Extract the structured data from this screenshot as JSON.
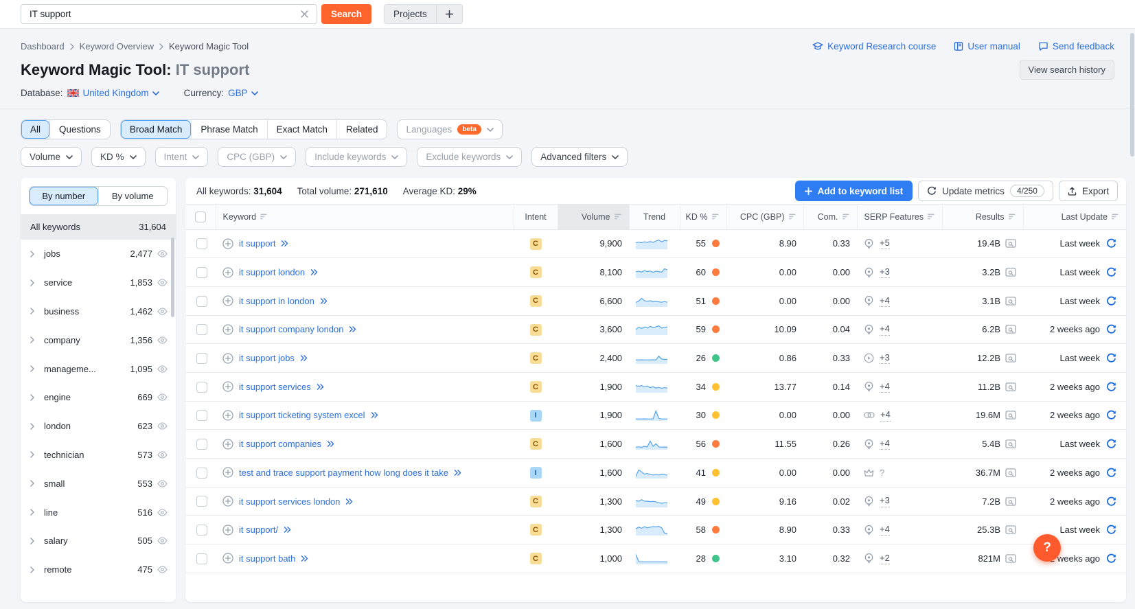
{
  "topbar": {
    "search_value": "IT support",
    "search_button": "Search",
    "projects_button": "Projects"
  },
  "header": {
    "breadcrumbs": [
      "Dashboard",
      "Keyword Overview",
      "Keyword Magic Tool"
    ],
    "links": [
      {
        "label": "Keyword Research course",
        "icon": "graduation-cap-icon"
      },
      {
        "label": "User manual",
        "icon": "book-icon"
      },
      {
        "label": "Send feedback",
        "icon": "feedback-icon"
      }
    ],
    "title_prefix": "Keyword Magic Tool:",
    "title_query": "IT support",
    "view_search_history": "View search history",
    "database_label": "Database:",
    "database_value": "United Kingdom",
    "currency_label": "Currency:",
    "currency_value": "GBP"
  },
  "filters": {
    "scope_tabs": [
      {
        "label": "All",
        "selected": true
      },
      {
        "label": "Questions",
        "selected": false
      }
    ],
    "match_tabs": [
      {
        "label": "Broad Match",
        "selected": true
      },
      {
        "label": "Phrase Match",
        "selected": false
      },
      {
        "label": "Exact Match",
        "selected": false
      },
      {
        "label": "Related",
        "selected": false
      }
    ],
    "languages": {
      "label": "Languages",
      "badge": "beta"
    },
    "dropdowns": [
      {
        "label": "Volume",
        "muted": false
      },
      {
        "label": "KD %",
        "muted": false
      },
      {
        "label": "Intent",
        "muted": true
      },
      {
        "label": "CPC (GBP)",
        "muted": true
      },
      {
        "label": "Include keywords",
        "muted": true
      },
      {
        "label": "Exclude keywords",
        "muted": true
      },
      {
        "label": "Advanced filters",
        "muted": false
      }
    ]
  },
  "sidebar": {
    "toggle": [
      {
        "label": "By number",
        "selected": true
      },
      {
        "label": "By volume",
        "selected": false
      }
    ],
    "all_row": {
      "label": "All keywords",
      "value": "31,604"
    },
    "groups": [
      {
        "label": "jobs",
        "value": "2,477"
      },
      {
        "label": "service",
        "value": "1,853"
      },
      {
        "label": "business",
        "value": "1,462"
      },
      {
        "label": "company",
        "value": "1,356"
      },
      {
        "label": "manageme...",
        "value": "1,095"
      },
      {
        "label": "engine",
        "value": "669"
      },
      {
        "label": "london",
        "value": "623"
      },
      {
        "label": "technician",
        "value": "573"
      },
      {
        "label": "small",
        "value": "553"
      },
      {
        "label": "line",
        "value": "516"
      },
      {
        "label": "salary",
        "value": "505"
      },
      {
        "label": "remote",
        "value": "475"
      }
    ]
  },
  "summary": {
    "all_keywords_label": "All keywords:",
    "all_keywords_value": "31,604",
    "total_volume_label": "Total volume:",
    "total_volume_value": "271,610",
    "avg_kd_label": "Average KD:",
    "avg_kd_value": "29%"
  },
  "actions": {
    "add_to_list": "Add to keyword list",
    "update_metrics": "Update metrics",
    "update_quota": "4/250",
    "export": "Export"
  },
  "table": {
    "columns": [
      {
        "key": "check",
        "label": "",
        "sortable": false,
        "align": "center",
        "sorted": false
      },
      {
        "key": "keyword",
        "label": "Keyword",
        "sortable": true,
        "align": "left",
        "sorted": false
      },
      {
        "key": "intent",
        "label": "Intent",
        "sortable": false,
        "align": "center",
        "sorted": false
      },
      {
        "key": "volume",
        "label": "Volume",
        "sortable": true,
        "align": "right",
        "sorted": true
      },
      {
        "key": "trend",
        "label": "Trend",
        "sortable": false,
        "align": "center",
        "sorted": false
      },
      {
        "key": "kd",
        "label": "KD %",
        "sortable": true,
        "align": "right",
        "sorted": false
      },
      {
        "key": "cpc",
        "label": "CPC (GBP)",
        "sortable": true,
        "align": "right",
        "sorted": false
      },
      {
        "key": "com",
        "label": "Com.",
        "sortable": true,
        "align": "right",
        "sorted": false
      },
      {
        "key": "serp",
        "label": "SERP Features",
        "sortable": true,
        "align": "left",
        "sorted": false
      },
      {
        "key": "results",
        "label": "Results",
        "sortable": true,
        "align": "right",
        "sorted": false
      },
      {
        "key": "update",
        "label": "Last Update",
        "sortable": true,
        "align": "right",
        "sorted": false
      }
    ],
    "rows": [
      {
        "keyword": "it support",
        "intent": "C",
        "volume": "9,900",
        "trend": [
          48,
          52,
          47,
          55,
          50,
          58,
          50,
          62,
          72,
          55,
          68,
          64
        ],
        "kd": "55",
        "kd_level": "hard",
        "cpc": "8.90",
        "com": "0.33",
        "serp_icon": "location-pin-icon",
        "serp_more": "+5",
        "results": "19.4B",
        "last_update": "Last week"
      },
      {
        "keyword": "it support london",
        "intent": "C",
        "volume": "8,100",
        "trend": [
          45,
          50,
          42,
          55,
          46,
          52,
          40,
          50,
          46,
          42,
          72,
          62
        ],
        "kd": "60",
        "kd_level": "hard",
        "cpc": "0.00",
        "com": "0.00",
        "serp_icon": "location-pin-icon",
        "serp_more": "+3",
        "results": "3.2B",
        "last_update": "Last week"
      },
      {
        "keyword": "it support in london",
        "intent": "C",
        "volume": "6,600",
        "trend": [
          28,
          40,
          66,
          44,
          38,
          44,
          34,
          38,
          34,
          30,
          36,
          30
        ],
        "kd": "51",
        "kd_level": "hard",
        "cpc": "0.00",
        "com": "0.00",
        "serp_icon": "location-pin-icon",
        "serp_more": "+4",
        "results": "3.1B",
        "last_update": "Last week"
      },
      {
        "keyword": "it support company london",
        "intent": "C",
        "volume": "3,600",
        "trend": [
          38,
          58,
          48,
          62,
          52,
          66,
          56,
          62,
          72,
          52,
          58,
          62
        ],
        "kd": "59",
        "kd_level": "hard",
        "cpc": "10.09",
        "com": "0.04",
        "serp_icon": "location-pin-icon",
        "serp_more": "+4",
        "results": "6.2B",
        "last_update": "2 weeks ago"
      },
      {
        "keyword": "it support jobs",
        "intent": "C",
        "volume": "2,400",
        "trend": [
          24,
          24,
          25,
          24,
          24,
          24,
          25,
          24,
          58,
          32,
          28,
          28
        ],
        "kd": "26",
        "kd_level": "easy",
        "cpc": "0.86",
        "com": "0.33",
        "serp_icon": "play-circle-icon",
        "serp_more": "+3",
        "results": "12.2B",
        "last_update": "Last week"
      },
      {
        "keyword": "it support services",
        "intent": "C",
        "volume": "1,900",
        "trend": [
          55,
          44,
          54,
          40,
          50,
          34,
          42,
          30,
          36,
          28,
          34,
          30
        ],
        "kd": "34",
        "kd_level": "medium",
        "cpc": "13.77",
        "com": "0.14",
        "serp_icon": "location-pin-icon",
        "serp_more": "+4",
        "results": "11.2B",
        "last_update": "2 weeks ago"
      },
      {
        "keyword": "it support ticketing system excel",
        "intent": "I",
        "volume": "1,900",
        "trend": [
          5,
          5,
          5,
          6,
          5,
          5,
          6,
          78,
          10,
          5,
          5,
          5
        ],
        "kd": "30",
        "kd_level": "medium",
        "cpc": "0.00",
        "com": "0.00",
        "serp_icon": "link-icon",
        "serp_more": "+4",
        "results": "19.6M",
        "last_update": "2 weeks ago"
      },
      {
        "keyword": "it support companies",
        "intent": "C",
        "volume": "1,600",
        "trend": [
          10,
          14,
          10,
          18,
          14,
          66,
          18,
          42,
          14,
          10,
          12,
          10
        ],
        "kd": "56",
        "kd_level": "hard",
        "cpc": "11.55",
        "com": "0.26",
        "serp_icon": "location-pin-icon",
        "serp_more": "+4",
        "results": "5.4B",
        "last_update": "Last week"
      },
      {
        "keyword": "test and trace support payment how long does it take",
        "intent": "I",
        "volume": "1,600",
        "trend": [
          8,
          66,
          48,
          28,
          34,
          24,
          20,
          24,
          20,
          28,
          24,
          18
        ],
        "kd": "41",
        "kd_level": "medium",
        "cpc": "0.00",
        "com": "0.00",
        "serp_icon": "crown-icon",
        "serp_more": "?",
        "serp_question": true,
        "results": "36.7M",
        "last_update": "2 weeks ago"
      },
      {
        "keyword": "it support services london",
        "intent": "C",
        "volume": "1,300",
        "trend": [
          50,
          44,
          58,
          44,
          44,
          40,
          42,
          38,
          30,
          25,
          30,
          28
        ],
        "kd": "49",
        "kd_level": "medium",
        "cpc": "9.16",
        "com": "0.02",
        "serp_icon": "location-pin-icon",
        "serp_more": "+3",
        "results": "7.2B",
        "last_update": "2 weeks ago"
      },
      {
        "keyword": "it support/",
        "intent": "C",
        "volume": "1,300",
        "trend": [
          48,
          64,
          54,
          68,
          58,
          64,
          68,
          66,
          70,
          58,
          10,
          6
        ],
        "kd": "58",
        "kd_level": "hard",
        "cpc": "8.90",
        "com": "0.33",
        "serp_icon": "location-pin-icon",
        "serp_more": "+4",
        "results": "25.3B",
        "last_update": "Last week"
      },
      {
        "keyword": "it support bath",
        "intent": "C",
        "volume": "1,000",
        "trend": [
          78,
          14,
          10,
          10,
          10,
          10,
          10,
          10,
          10,
          10,
          10,
          10
        ],
        "kd": "28",
        "kd_level": "easy",
        "cpc": "3.10",
        "com": "0.32",
        "serp_icon": "location-pin-icon",
        "serp_more": "+2",
        "results": "821M",
        "last_update": "2 weeks ago"
      }
    ]
  },
  "colors": {
    "accent_orange": "#ff642d",
    "primary_blue": "#2f7df2",
    "link_blue": "#2b6fdb",
    "kd_hard": "#ff7a3d",
    "kd_medium": "#ffc130",
    "kd_easy": "#3fc489",
    "intent_c_bg": "#f8dd96",
    "intent_c_text": "#8a5200",
    "intent_i_bg": "#a9d7f5",
    "intent_i_text": "#1865ab",
    "trend_line": "#56a4e8",
    "trend_fill": "#d9ecfb"
  },
  "help_button": "?"
}
